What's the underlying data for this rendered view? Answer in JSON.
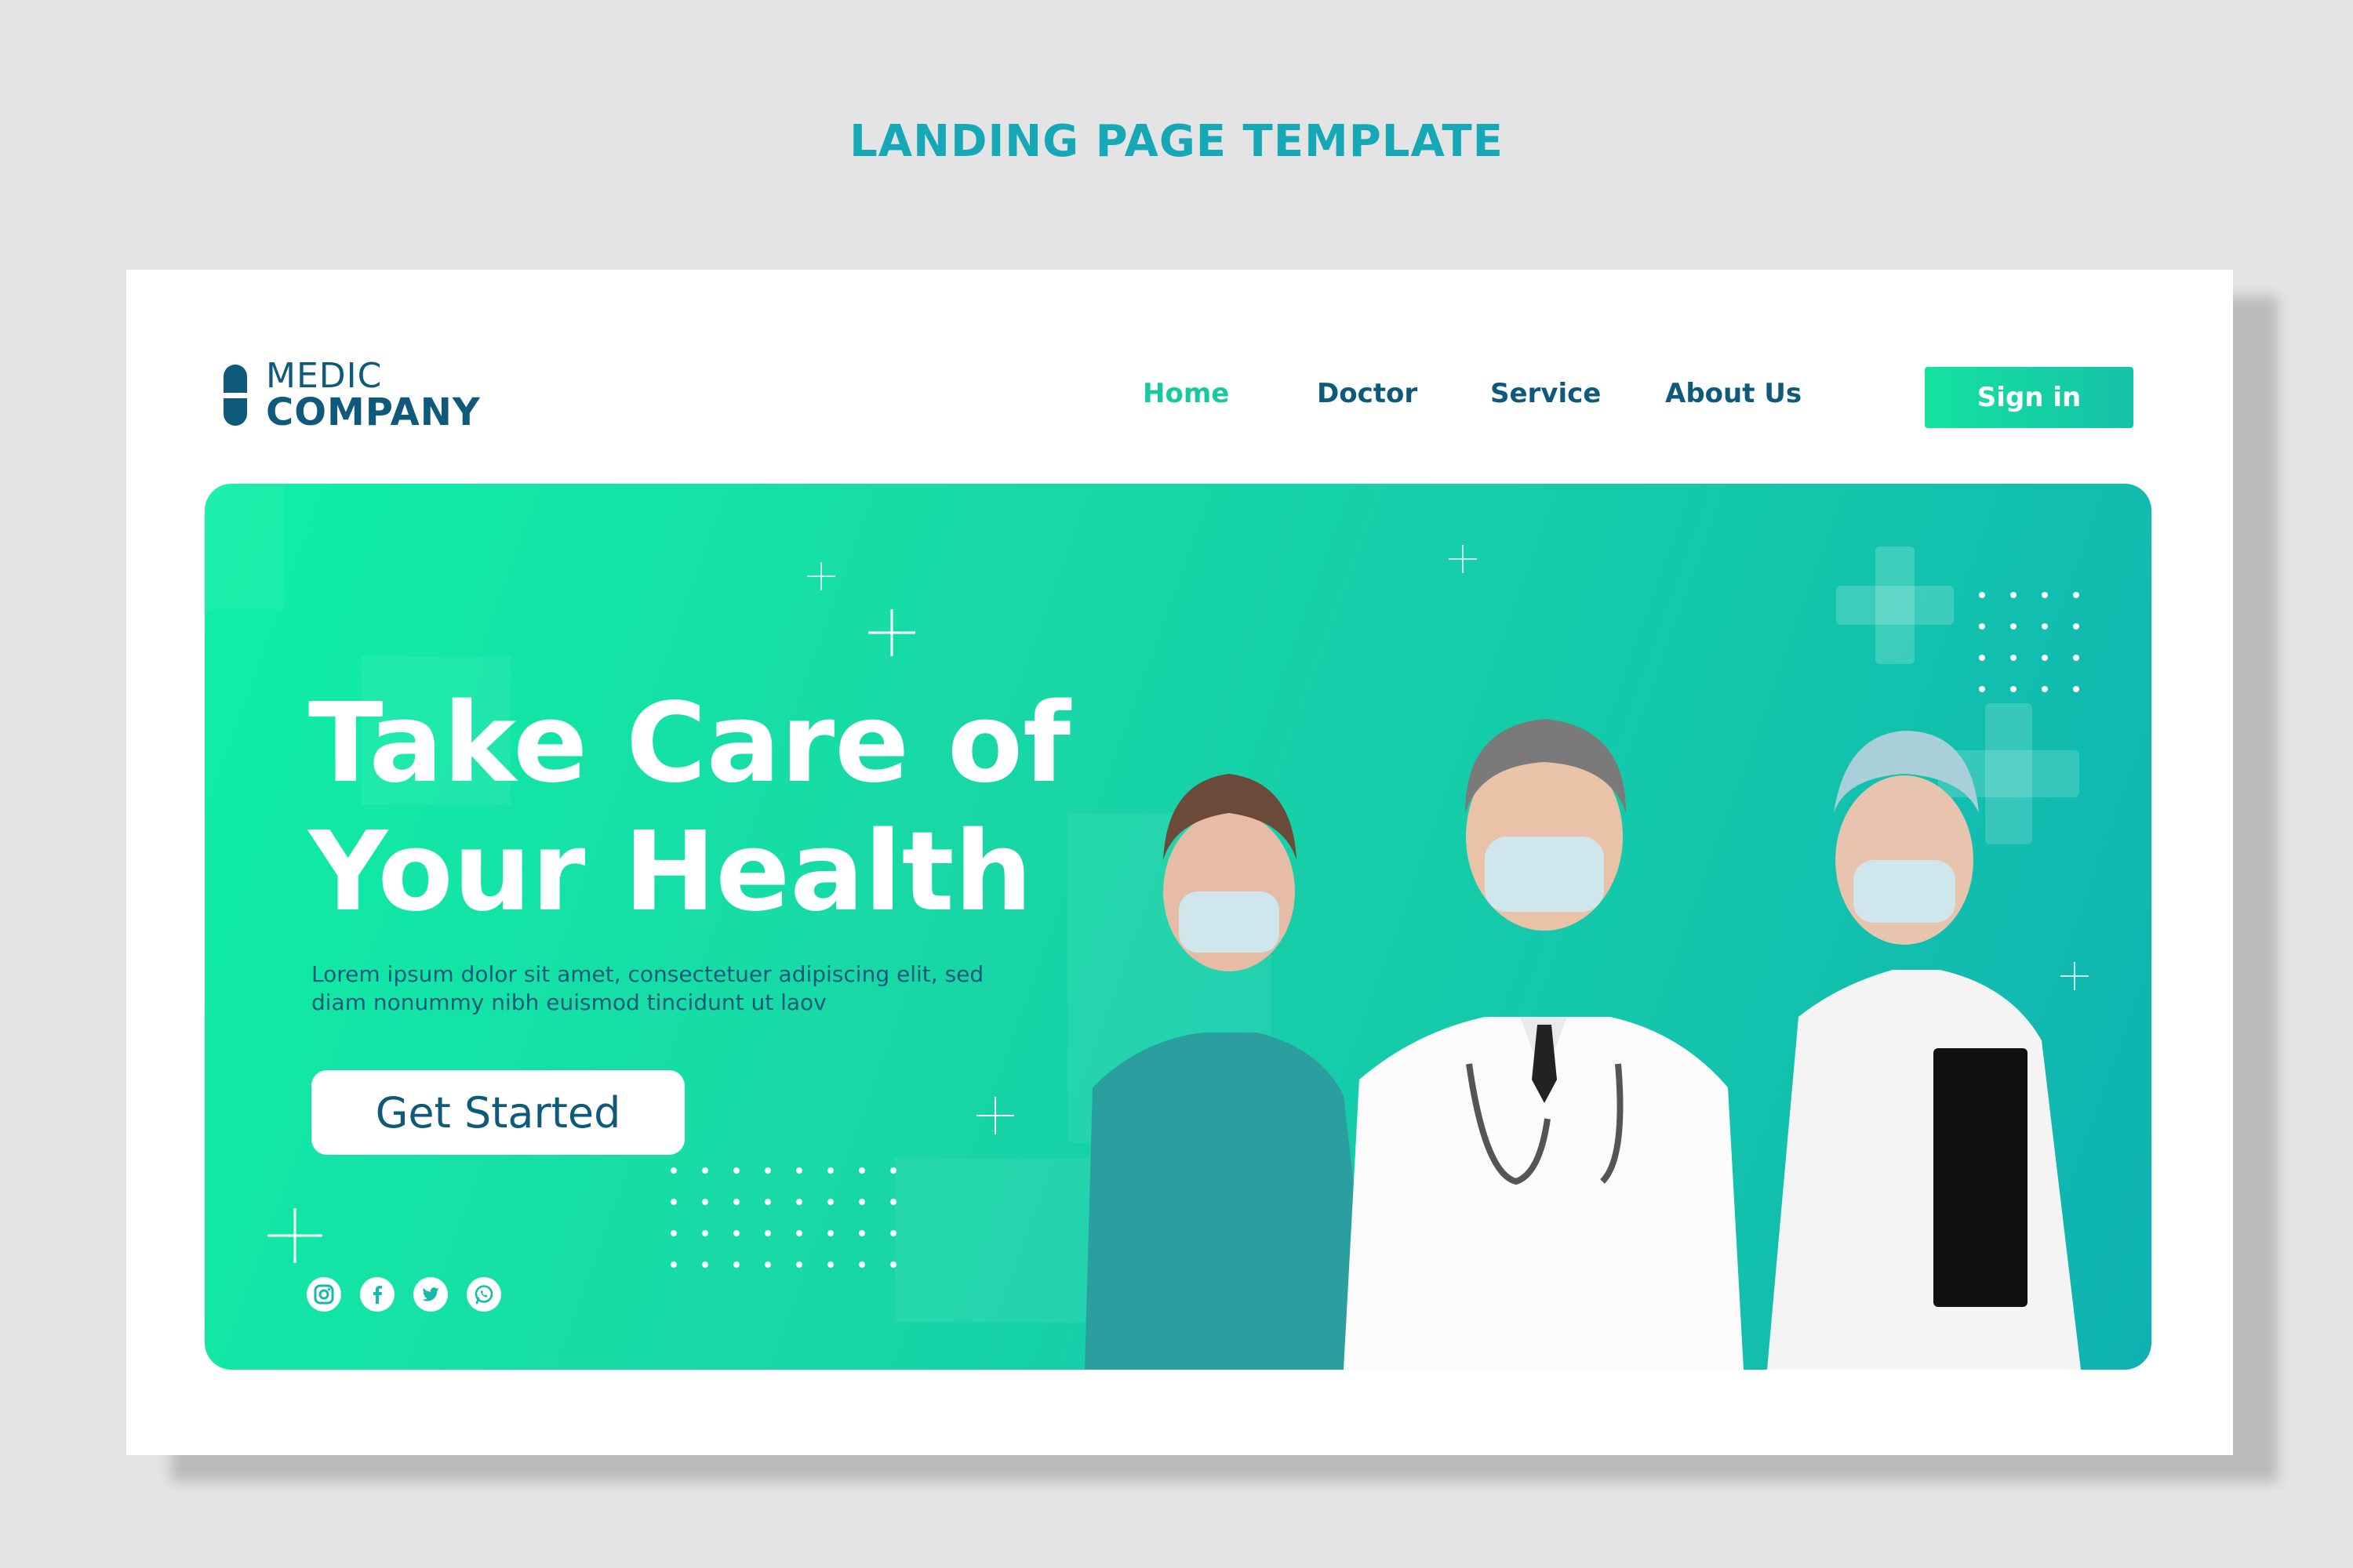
{
  "showcase_title": "LANDING PAGE TEMPLATE",
  "brand": {
    "line1": "MEDIC",
    "line2": "COMPANY",
    "color": "#0f5a7a"
  },
  "nav": {
    "items": [
      {
        "label": "Home",
        "active": true
      },
      {
        "label": "Doctor",
        "active": false
      },
      {
        "label": "Service",
        "active": false
      },
      {
        "label": "About Us",
        "active": false
      }
    ],
    "signin_label": "Sign in"
  },
  "hero": {
    "title_line1": "Take Care of",
    "title_line2": "Your Health",
    "subtitle": "Lorem ipsum dolor sit amet, consectetuer adipiscing elit, sed diam nonummy nibh euismod tincidunt ut laov",
    "cta_label": "Get Started",
    "social_icons": [
      "instagram-icon",
      "facebook-icon",
      "twitter-icon",
      "whatsapp-icon"
    ],
    "photo": "three-medical-staff-in-masks"
  },
  "colors": {
    "accent_teal": "#17a8b8",
    "accent_green": "#18c9a0",
    "navy": "#0f5a7a",
    "page_bg": "#e4e4e4"
  }
}
